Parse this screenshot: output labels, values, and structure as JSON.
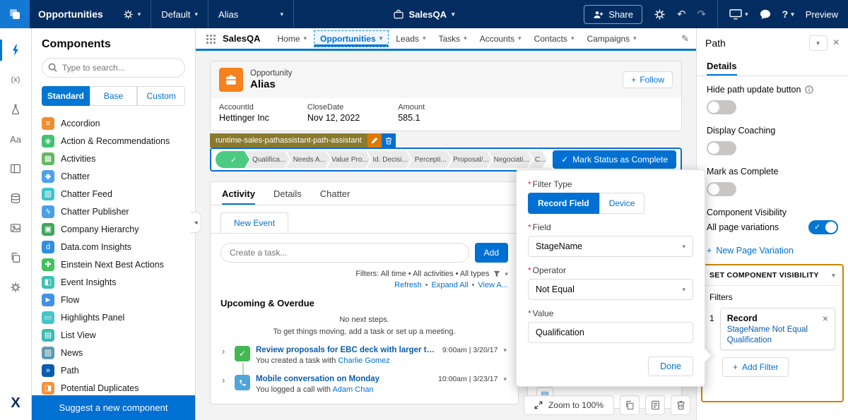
{
  "colors": {
    "topbar_bg": "#032d60",
    "accent": "#0176d3",
    "link": "#0070d2",
    "canvas_bg": "#f3f3f3",
    "selection_border": "#0070d2",
    "tag_bg": "#8a7a2e",
    "tag_edit_bg": "#dd7a01",
    "tag_delete_bg": "#0070d2",
    "visibility_border": "#ca8501",
    "stage_complete": "#4bca81",
    "opportunity_icon": "#f5811f"
  },
  "topbar": {
    "title": "Opportunities",
    "page": "Default",
    "record": "Alias",
    "app": "SalesQA",
    "share": "Share",
    "preview": "Preview"
  },
  "components": {
    "title": "Components",
    "search_placeholder": "Type to search...",
    "tabs": [
      {
        "label": "Standard"
      },
      {
        "label": "Base"
      },
      {
        "label": "Custom"
      }
    ],
    "items": [
      {
        "label": "Accordion",
        "glyph": "≡",
        "color": "#ef8e2e"
      },
      {
        "label": "Action & Recommendations",
        "glyph": "◈",
        "color": "#45c174"
      },
      {
        "label": "Activities",
        "glyph": "▦",
        "color": "#62b85e"
      },
      {
        "label": "Chatter",
        "glyph": "◆",
        "color": "#4da1f0"
      },
      {
        "label": "Chatter Feed",
        "glyph": "▥",
        "color": "#3fc5c9"
      },
      {
        "label": "Chatter Publisher",
        "glyph": "ϟ",
        "color": "#4a9fe6"
      },
      {
        "label": "Company Hierarchy",
        "glyph": "▣",
        "color": "#3fa65a"
      },
      {
        "label": "Data.com Insights",
        "glyph": "d",
        "color": "#2f8fe0"
      },
      {
        "label": "Einstein Next Best Actions",
        "glyph": "✚",
        "color": "#41c25e"
      },
      {
        "label": "Event Insights",
        "glyph": "◧",
        "color": "#3cc0b4"
      },
      {
        "label": "Flow",
        "glyph": "►",
        "color": "#4390e8"
      },
      {
        "label": "Highlights Panel",
        "glyph": "▭",
        "color": "#41c6ca"
      },
      {
        "label": "List View",
        "glyph": "▤",
        "color": "#3bbcb2"
      },
      {
        "label": "News",
        "glyph": "▥",
        "color": "#5e9ab0"
      },
      {
        "label": "Path",
        "glyph": "»",
        "color": "#0b5cab"
      },
      {
        "label": "Potential Duplicates",
        "glyph": "◨",
        "color": "#f2933c"
      }
    ],
    "suggest": "Suggest a new component"
  },
  "nav": {
    "app": "SalesQA",
    "tabs": [
      {
        "label": "Home"
      },
      {
        "label": "Opportunities"
      },
      {
        "label": "Leads"
      },
      {
        "label": "Tasks"
      },
      {
        "label": "Accounts"
      },
      {
        "label": "Contacts"
      },
      {
        "label": "Campaigns"
      }
    ]
  },
  "record": {
    "entity": "Opportunity",
    "name": "Alias",
    "follow": "Follow",
    "fields": [
      {
        "label": "AccountId",
        "value": "Hettinger Inc"
      },
      {
        "label": "CloseDate",
        "value": "Nov 12, 2022"
      },
      {
        "label": "Amount",
        "value": "585.1"
      }
    ]
  },
  "path": {
    "tag": "runtime-sales-pathassistant-path-assistant",
    "stages": [
      {
        "label": "Qualifica..."
      },
      {
        "label": "Needs A..."
      },
      {
        "label": "Value Pro..."
      },
      {
        "label": "Id. Decisi..."
      },
      {
        "label": "Percepti..."
      },
      {
        "label": "Proposal/..."
      },
      {
        "label": "Negociati..."
      },
      {
        "label": "C..."
      }
    ],
    "mark_complete": "Mark Status as Complete"
  },
  "activity": {
    "tabs": [
      {
        "label": "Activity"
      },
      {
        "label": "Details"
      },
      {
        "label": "Chatter"
      }
    ],
    "subtab": "New Event",
    "task_placeholder": "Create a task...",
    "add": "Add",
    "filters": "Filters: All time • All activities • All types",
    "refresh": "Refresh",
    "expand_all": "Expand All",
    "view_all": "View A...",
    "section": "Upcoming & Overdue",
    "empty_title": "No next steps.",
    "empty_body": "To get things moving, add a task or set up a meeting.",
    "tasks": [
      {
        "title": "Review proposals for EBC deck with larger team and have market...",
        "time": "9:00am | 3/20/17",
        "body": "You created a task with",
        "link": "Charlie Gomez",
        "icon_color": "#43b754"
      },
      {
        "title": "Mobile conversation on Monday",
        "time": "10:00am | 3/23/17",
        "body": "You logged a call with",
        "link": "Adam Chan",
        "icon_color": "#50a5d8"
      }
    ]
  },
  "toolbar": {
    "zoom": "Zoom to 100%"
  },
  "popup": {
    "filter_type_label": "Filter Type",
    "record_field": "Record Field",
    "device": "Device",
    "field_label": "Field",
    "field_value": "StageName",
    "operator_label": "Operator",
    "operator_value": "Not Equal",
    "value_label": "Value",
    "value": "Qualification",
    "done": "Done"
  },
  "panel": {
    "title": "Path",
    "tab": "Details",
    "toggle1": "Hide path update button",
    "toggle2": "Display Coaching",
    "toggle3": "Mark as Complete",
    "visibility_title": "Component Visibility",
    "visibility_scope": "All page variations",
    "new_variation": "New Page Variation",
    "set_visibility": "SET COMPONENT VISIBILITY",
    "filters": "Filters",
    "filter_index": "1",
    "filter_title": "Record",
    "filter_line1": "StageName Not Equal",
    "filter_line2": "Qualification",
    "add_filter": "Add Filter"
  }
}
